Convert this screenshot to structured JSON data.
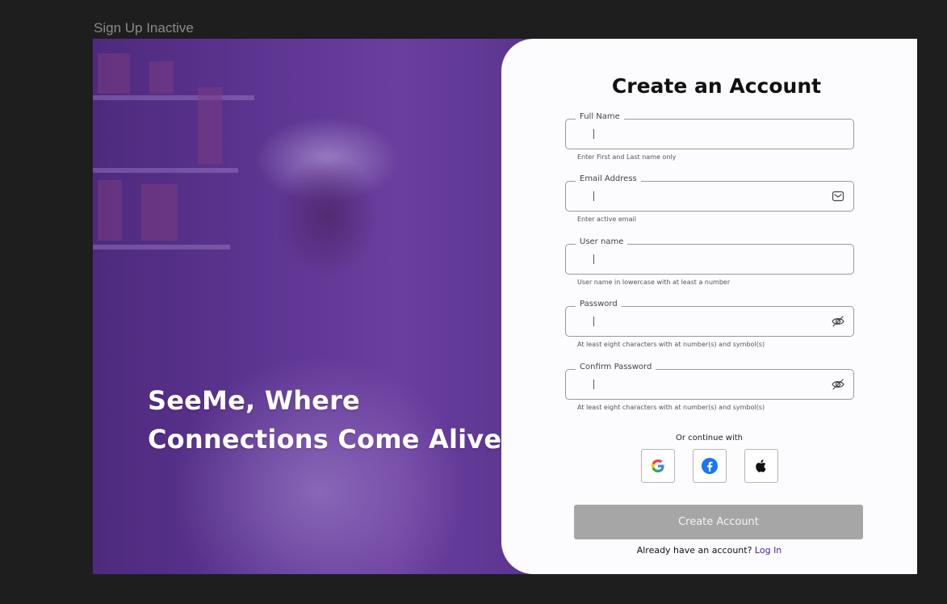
{
  "frame": {
    "label": "Sign Up Inactive"
  },
  "hero": {
    "tagline_line1": "SeeMe, Where",
    "tagline_line2": "Connections Come Alive."
  },
  "form": {
    "title": "Create an Account",
    "fields": [
      {
        "label": "Full Name",
        "value": "",
        "hint": "Enter First and Last name only",
        "suffix_icon": ""
      },
      {
        "label": "Email Address",
        "value": "",
        "hint": "Enter active email",
        "suffix_icon": "mail-icon"
      },
      {
        "label": "User name",
        "value": "",
        "hint": "User name in lowercase with at least a number",
        "suffix_icon": ""
      },
      {
        "label": "Password",
        "value": "",
        "hint": "At least eight characters with at number(s) and symbol(s)",
        "suffix_icon": "eye-off-icon"
      },
      {
        "label": "Confirm Password",
        "value": "",
        "hint": "At least eight characters with at number(s) and symbol(s)",
        "suffix_icon": "eye-off-icon"
      }
    ],
    "or_continue": "Or continue with",
    "social": [
      "google-icon",
      "facebook-icon",
      "apple-icon"
    ],
    "submit_label": "Create Account",
    "login_prompt": "Already have an account?",
    "login_link": "Log In"
  },
  "colors": {
    "overlay": "#5b3590",
    "panel_bg": "#fcfcff",
    "button_disabled": "#a6a6a6",
    "link": "#4b1f91",
    "facebook": "#1877f2"
  }
}
